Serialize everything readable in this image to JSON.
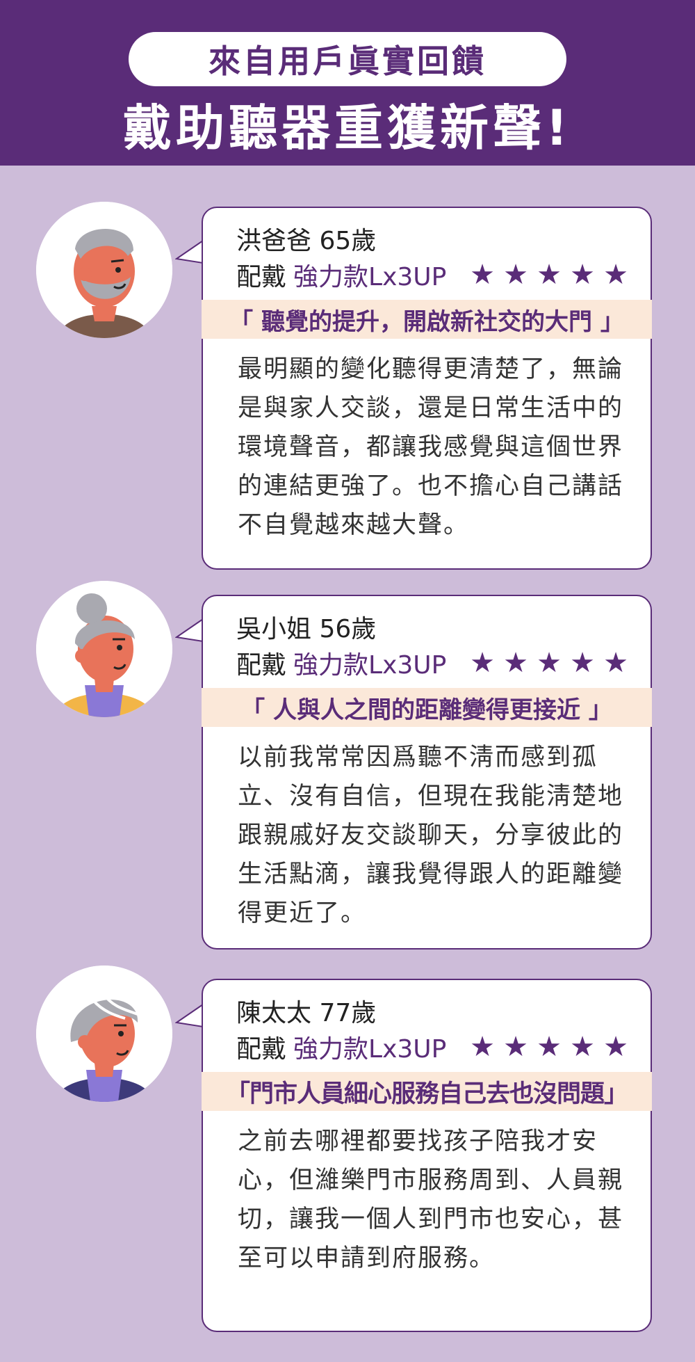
{
  "header": {
    "pill_text": "來自用戶眞實回饋",
    "title": "戴助聽器重獲新聲!"
  },
  "colors": {
    "brand_purple": "#5a2c78",
    "background": "#cdbcd9",
    "quote_highlight": "#fbe8d9",
    "card_bg": "#ffffff"
  },
  "testimonials": [
    {
      "name": "洪爸爸 65歲",
      "wear_label": "配戴",
      "product": "強力款Lx3UP",
      "rating": 5,
      "stars": [
        "★",
        "★",
        "★",
        "★",
        "★"
      ],
      "quote": "「 聽覺的提升，開啟新社交的大門 」",
      "body": "最明顯的變化聽得更清楚了，無論是與家人交談，還是日常生活中的環境聲音，都讓我感覺與這個世界的連結更強了。也不擔心自己講話不自覺越來越大聲。",
      "avatar_icon": "grandpa-avatar-icon"
    },
    {
      "name": "吳小姐 56歲",
      "wear_label": "配戴",
      "product": "強力款Lx3UP",
      "rating": 5,
      "stars": [
        "★",
        "★",
        "★",
        "★",
        "★"
      ],
      "quote": "「 人與人之間的距離變得更接近 」",
      "body": "以前我常常因爲聽不淸而感到孤立、沒有自信，但現在我能淸楚地跟親戚好友交談聊天，分享彼此的生活點滴，讓我覺得跟人的距離變得更近了。",
      "avatar_icon": "woman-avatar-icon"
    },
    {
      "name": "陳太太 77歲",
      "wear_label": "配戴",
      "product": "強力款Lx3UP",
      "rating": 5,
      "stars": [
        "★",
        "★",
        "★",
        "★",
        "★"
      ],
      "quote": "「門市人員細心服務自己去也沒問題」",
      "body": "之前去哪裡都要找孩子陪我才安心，但濰樂門市服務周到、人員親切，讓我一個人到門市也安心，甚至可以申請到府服務。",
      "avatar_icon": "grandma-avatar-icon"
    }
  ]
}
